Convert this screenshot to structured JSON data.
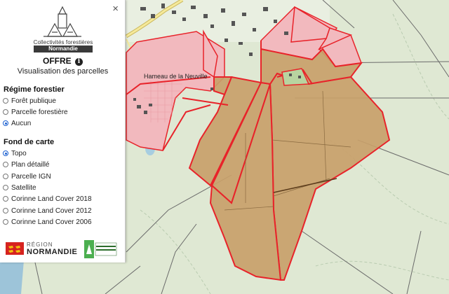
{
  "panel": {
    "close_label": "×",
    "logo": {
      "line1": "Collectivités forestières",
      "line2": "Normandie"
    },
    "offre_title": "OFFRE",
    "info_glyph": "i",
    "subtitle": "Visualisation des parcelles",
    "regime": {
      "title": "Régime forestier",
      "options": [
        {
          "label": "Forêt publique",
          "checked": false
        },
        {
          "label": "Parcelle forestière",
          "checked": false
        },
        {
          "label": "Aucun",
          "checked": true
        }
      ]
    },
    "basemap": {
      "title": "Fond de carte",
      "options": [
        {
          "label": "Topo",
          "checked": true
        },
        {
          "label": "Plan détaillé",
          "checked": false
        },
        {
          "label": "Parcelle IGN",
          "checked": false
        },
        {
          "label": "Satellite",
          "checked": false
        },
        {
          "label": "Corinne Land Cover 2018",
          "checked": false
        },
        {
          "label": "Corinne Land Cover 2012",
          "checked": false
        },
        {
          "label": "Corinne Land Cover 2006",
          "checked": false
        }
      ]
    },
    "footer": {
      "region_small": "RÉGION",
      "region_big": "NORMANDIE"
    }
  },
  "map": {
    "place_label": "Hameau de la Neuville",
    "colors": {
      "background": "#dfe8d3",
      "parcel_fill": "#c8a06a",
      "parcel_outline": "#e8232a",
      "pink_fill": "#f2b9be",
      "road": "#f5e99a",
      "building": "#555555"
    }
  }
}
